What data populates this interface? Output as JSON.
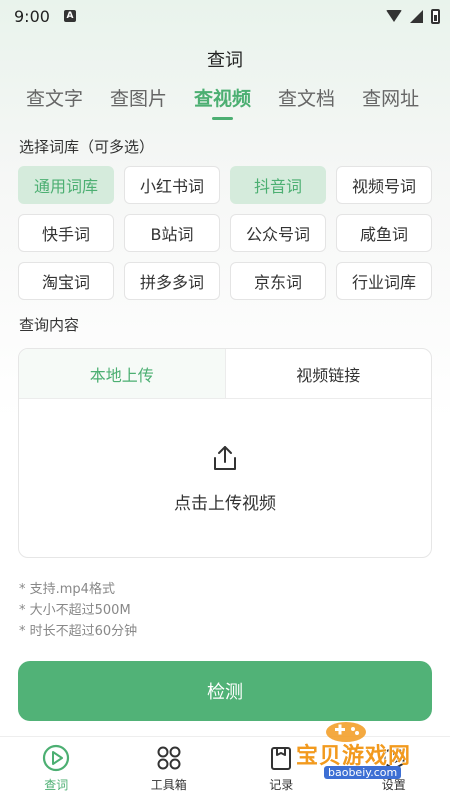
{
  "status_bar": {
    "time": "9:00",
    "notification_icon": "A"
  },
  "header": {
    "title": "查词"
  },
  "tabs": [
    {
      "label": "查文字"
    },
    {
      "label": "查图片"
    },
    {
      "label": "查视频",
      "active": true
    },
    {
      "label": "查文档"
    },
    {
      "label": "查网址"
    }
  ],
  "library": {
    "label": "选择词库（可多选）",
    "items": [
      {
        "label": "通用词库",
        "selected": true
      },
      {
        "label": "小红书词"
      },
      {
        "label": "抖音词",
        "selected": true
      },
      {
        "label": "视频号词"
      },
      {
        "label": "快手词"
      },
      {
        "label": "B站词"
      },
      {
        "label": "公众号词"
      },
      {
        "label": "咸鱼词"
      },
      {
        "label": "淘宝词"
      },
      {
        "label": "拼多多词"
      },
      {
        "label": "京东词"
      },
      {
        "label": "行业词库"
      }
    ]
  },
  "query": {
    "label": "查询内容",
    "tabs": [
      {
        "label": "本地上传",
        "active": true
      },
      {
        "label": "视频链接"
      }
    ],
    "upload_text": "点击上传视频",
    "upload_icon": "upload-icon"
  },
  "notes": [
    "* 支持.mp4格式",
    "* 大小不超过500M",
    "* 时长不超过60分钟"
  ],
  "detect_button": "检测",
  "bottom_nav": [
    {
      "label": "查词",
      "icon": "search-word-icon",
      "active": true
    },
    {
      "label": "工具箱",
      "icon": "grid-icon"
    },
    {
      "label": "记录",
      "icon": "record-icon"
    },
    {
      "label": "设置",
      "icon": "settings-icon"
    }
  ],
  "watermark": {
    "text": "宝贝游戏网",
    "sub": "baobeiy.com"
  },
  "colors": {
    "accent": "#4caf72",
    "button": "#51b277",
    "chip_selected_bg": "#d5ebdc"
  }
}
